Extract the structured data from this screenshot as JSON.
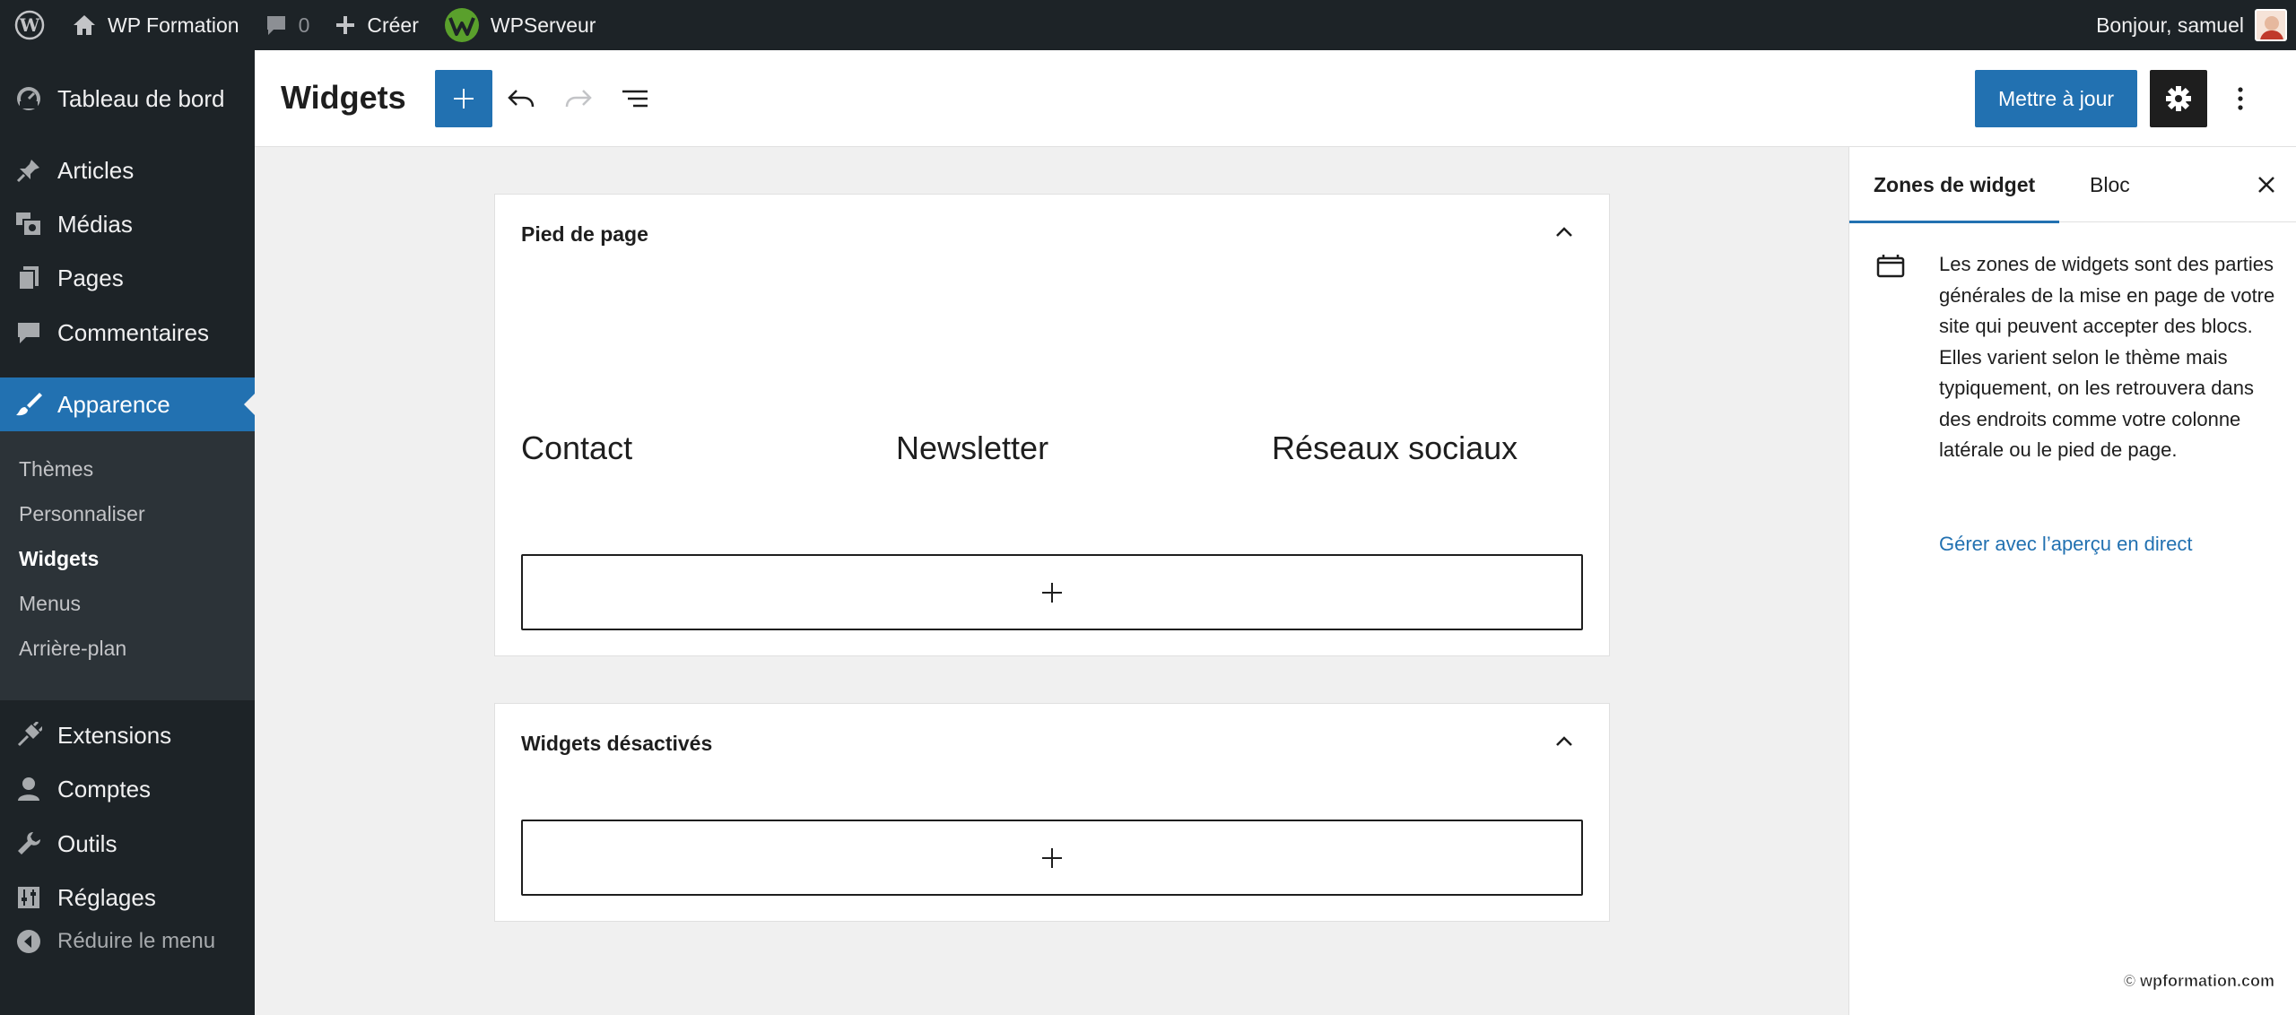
{
  "adminbar": {
    "site_name": "WP Formation",
    "comments_count": "0",
    "new_label": "Créer",
    "plugin_label": "WPServeur",
    "greeting": "Bonjour, samuel"
  },
  "menu": {
    "dashboard": "Tableau de bord",
    "posts": "Articles",
    "media": "Médias",
    "pages": "Pages",
    "comments": "Commentaires",
    "appearance": "Apparence",
    "submenu": [
      "Thèmes",
      "Personnaliser",
      "Widgets",
      "Menus",
      "Arrière-plan"
    ],
    "plugins": "Extensions",
    "users": "Comptes",
    "tools": "Outils",
    "settings": "Réglages",
    "collapse": "Réduire le menu"
  },
  "header": {
    "title": "Widgets",
    "update_label": "Mettre à jour"
  },
  "areas": {
    "footer": {
      "title": "Pied de page",
      "columns": [
        "Contact",
        "Newsletter",
        "Réseaux sociaux"
      ]
    },
    "inactive": {
      "title": "Widgets désactivés"
    }
  },
  "panel": {
    "tab_zones": "Zones de widget",
    "tab_block": "Bloc",
    "description": "Les zones de widgets sont des parties générales de la mise en page de votre site qui peuvent accepter des blocs. Elles varient selon le thème mais typiquement, on les retrouvera dans des endroits comme votre colonne latérale ou le pied de page.",
    "link": "Gérer avec l’aperçu en direct",
    "watermark": "© wpformation.com"
  },
  "colors": {
    "accent": "#2271b1",
    "adminbar_bg": "#1d2327",
    "submenu_bg": "#2c3338",
    "canvas_bg": "#f0f0f0"
  }
}
